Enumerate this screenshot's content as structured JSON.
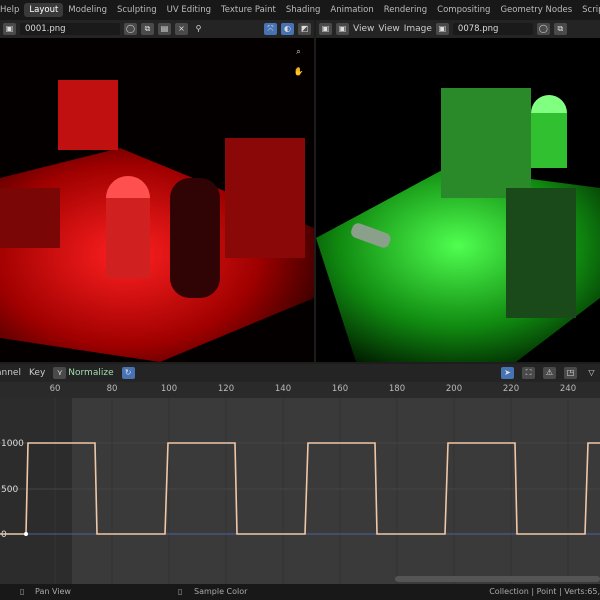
{
  "menu": {
    "help": "Help"
  },
  "workspaces": [
    "Layout",
    "Modeling",
    "Sculpting",
    "UV Editing",
    "Texture Paint",
    "Shading",
    "Animation",
    "Rendering",
    "Compositing",
    "Geometry Nodes",
    "Scripting"
  ],
  "left_editor": {
    "image_name": "0001.png"
  },
  "right_editor": {
    "view_menu": "View",
    "view": "View",
    "image": "Image",
    "image_name": "0078.png"
  },
  "graph_header": {
    "channel": "Channel",
    "key": "Key",
    "normalize": "Normalize"
  },
  "ruler_ticks": [
    "60",
    "80",
    "100",
    "120",
    "140",
    "160",
    "180",
    "200",
    "220",
    "240"
  ],
  "y_labels": [
    "1000",
    "500",
    "0"
  ],
  "status": {
    "pan": "Pan View",
    "sample": "Sample Color",
    "info": "Collection | Point | Verts:65,"
  },
  "chart_data": {
    "type": "line",
    "series": [
      {
        "name": "square wave",
        "period_frames": 49,
        "values_range": [
          0,
          1000
        ]
      }
    ]
  }
}
